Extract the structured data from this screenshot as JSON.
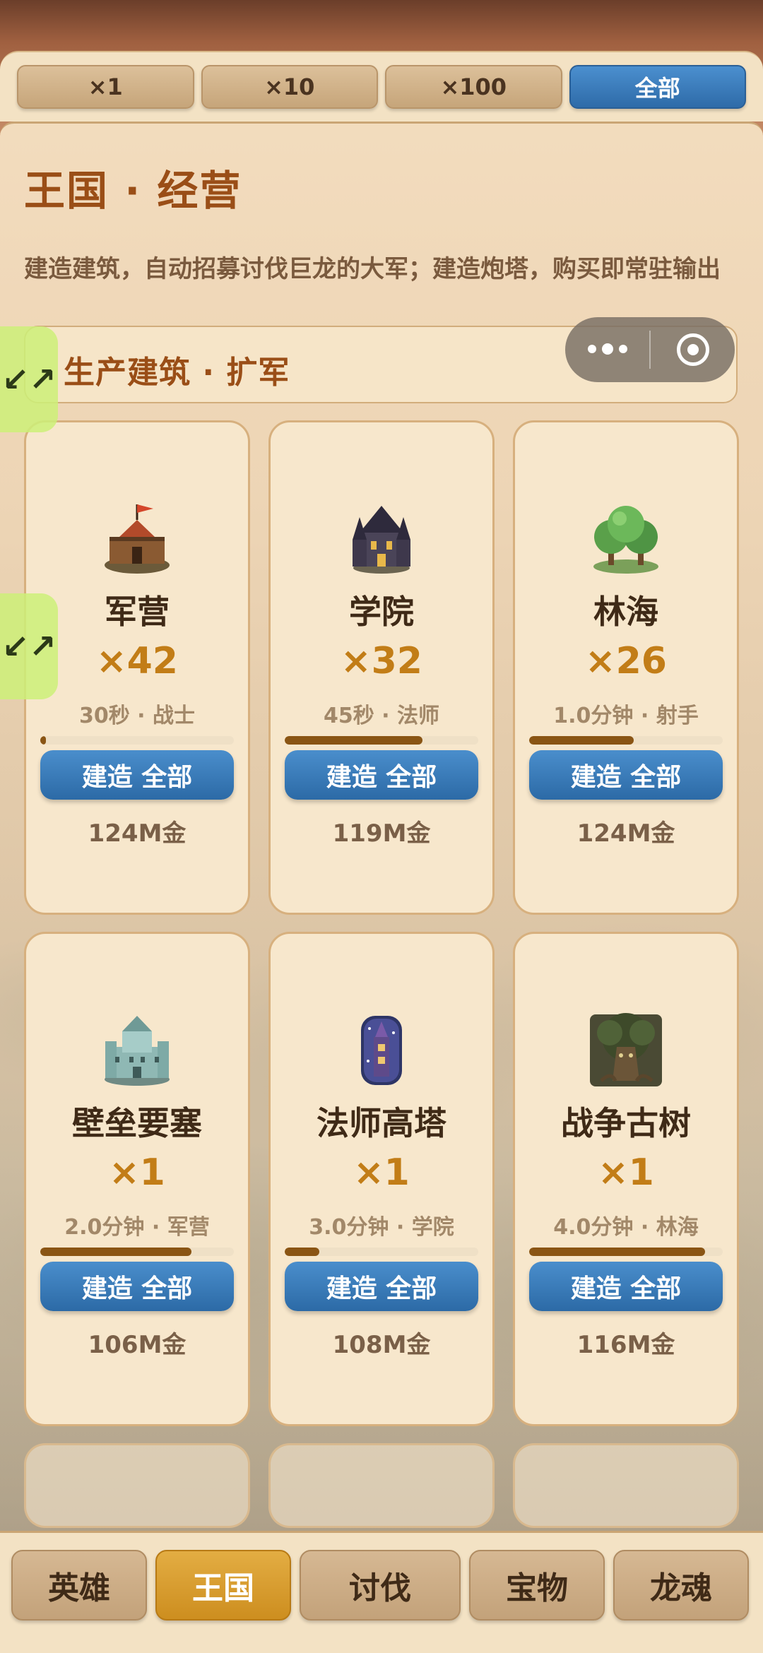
{
  "multipliers": [
    {
      "label": "×1",
      "active": false
    },
    {
      "label": "×10",
      "active": false
    },
    {
      "label": "×100",
      "active": false
    },
    {
      "label": "全部",
      "active": true
    }
  ],
  "header": {
    "title": "王国 · 经营",
    "description": "建造建筑，自动招募讨伐巨龙的大军；建造炮塔，购买即常驻输出"
  },
  "section": {
    "title": "生产建筑 · 扩军"
  },
  "expand_icon": "↙↗",
  "buildings": [
    {
      "name": "军营",
      "count": "×42",
      "info": "30秒 · 战士",
      "progress": 0.03,
      "build_label": "建造 全部",
      "cost": "124M金",
      "icon": "barracks-icon"
    },
    {
      "name": "学院",
      "count": "×32",
      "info": "45秒 · 法师",
      "progress": 0.71,
      "build_label": "建造 全部",
      "cost": "119M金",
      "icon": "academy-icon"
    },
    {
      "name": "林海",
      "count": "×26",
      "info": "1.0分钟 · 射手",
      "progress": 0.54,
      "build_label": "建造 全部",
      "cost": "124M金",
      "icon": "forest-icon"
    },
    {
      "name": "壁垒要塞",
      "count": "×1",
      "info": "2.0分钟 · 军营",
      "progress": 0.78,
      "build_label": "建造 全部",
      "cost": "106M金",
      "icon": "fortress-icon"
    },
    {
      "name": "法师高塔",
      "count": "×1",
      "info": "3.0分钟 · 学院",
      "progress": 0.18,
      "build_label": "建造 全部",
      "cost": "108M金",
      "icon": "mage-tower-icon"
    },
    {
      "name": "战争古树",
      "count": "×1",
      "info": "4.0分钟 · 林海",
      "progress": 0.91,
      "build_label": "建造 全部",
      "cost": "116M金",
      "icon": "war-tree-icon"
    }
  ],
  "nav": [
    {
      "label": "英雄",
      "active": false
    },
    {
      "label": "王国",
      "active": true
    },
    {
      "label": "讨伐",
      "active": false
    },
    {
      "label": "宝物",
      "active": false
    },
    {
      "label": "龙魂",
      "active": false
    }
  ],
  "colors": {
    "accent_blue": "#2e6ba8",
    "accent_gold": "#cd8e1f",
    "title_brown": "#9a4e17",
    "count_gold": "#c27d17"
  }
}
